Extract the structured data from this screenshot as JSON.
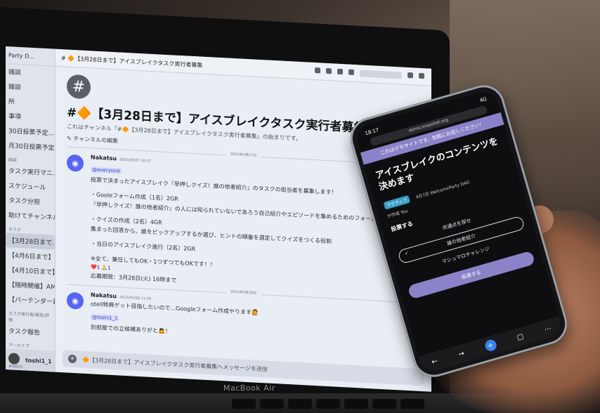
{
  "laptop": {
    "model": "MacBook Air"
  },
  "discord": {
    "server_name": "Party D...",
    "sidebar": {
      "items": [
        {
          "label": "雑談"
        },
        {
          "label": "雑談"
        },
        {
          "label": "所"
        },
        {
          "label": "事項"
        },
        {
          "label": "30日投票予定..."
        },
        {
          "label": "月30日投票予定..."
        },
        {
          "label": "タスク実行マニ..."
        },
        {
          "label": "スケジュール"
        },
        {
          "label": "タスク分担"
        },
        {
          "label": "助けてチャンネル"
        },
        {
          "label": "【3月28日まで..."
        },
        {
          "label": "【4月6日まで】リ..."
        },
        {
          "label": "【4月10日まで】プ..."
        },
        {
          "label": "【随時開催】AMA..."
        },
        {
          "label": "【バーテンダー募集..."
        },
        {
          "label": "タスク報告"
        }
      ],
      "categories": [
        "画談",
        "タスク",
        "タスク実行者/報告/評価",
        "アーカイブ"
      ],
      "user": {
        "name": "toshi1_1",
        "tag": "#9850"
      }
    },
    "topbar": {
      "channel": "# 🔶【3月28日まで】アイスブレイクタスク実行者募集"
    },
    "welcome": {
      "title": "#🔶【3月28日まで】アイスブレイクタスク実行者募集へようこそ！",
      "subtitle": "これはチャンネル「#🔶【3月28日まで】アイスブレイクタスク実行者募集」の始まりです。",
      "edit": "✎ チャンネルの編集"
    },
    "date_divider_1": "2023年3月27日",
    "date_divider_2": "2023年3月28日",
    "message1": {
      "author": "Nakatsu",
      "time": "2023/03/27 10:37",
      "mention": "@everyone",
      "lines": [
        "投票で決まったアイスブレイク『早押しクイズ！誰の他者紹介』のタスクの担当者を募集します！",
        "・Gooleフォーム作成（1名）2GR",
        "『早押しクイズ！誰の他者紹介』の人には知られていないであろう自己紹介やエピソードを集めるためのフォーム",
        "・クイズの作成（2名）4GR",
        "集まった回答から、誰をピックアップするか選び、ヒントの順番を選定してクイズをつくる役割",
        "・当日のアイスブレイク進行（2名）2GR",
        "※全て、兼任してもOK・1つずつでもOKです！！"
      ],
      "reactions": "❤️1  🙏1",
      "deadline": "応募期限：3月28日(火) 16時まで"
    },
    "message2": {
      "author": "Nakatsu",
      "time": "2023/03/28 11:39",
      "line1": "otell特典ゲット目指したいので...Googleフォーム作成やります🙋",
      "mention": "@toshi1_1",
      "line2": "別部屋での立候補ありがと🙇！"
    },
    "composer": {
      "placeholder": "🔶【3月28日まで】アイスブレイクタスク実行者募集へメッセージを送信"
    }
  },
  "phone": {
    "time": "18:17",
    "signal": "4G",
    "url": "demo.snapshot.org",
    "banner": "これはデモサイトです。気軽にお試しください！",
    "title": "アイスブレイクのコンテンツを決めます",
    "badge": "アクティブ",
    "meta": "4月7日 WelcomeParty DAO",
    "creator": "が作成 You",
    "vote_heading": "投票する",
    "options": [
      "共通点を探せ",
      "誰の他者紹介",
      "マシュマロチャレンジ"
    ],
    "selected_index": 1,
    "vote_button": "投票する"
  }
}
